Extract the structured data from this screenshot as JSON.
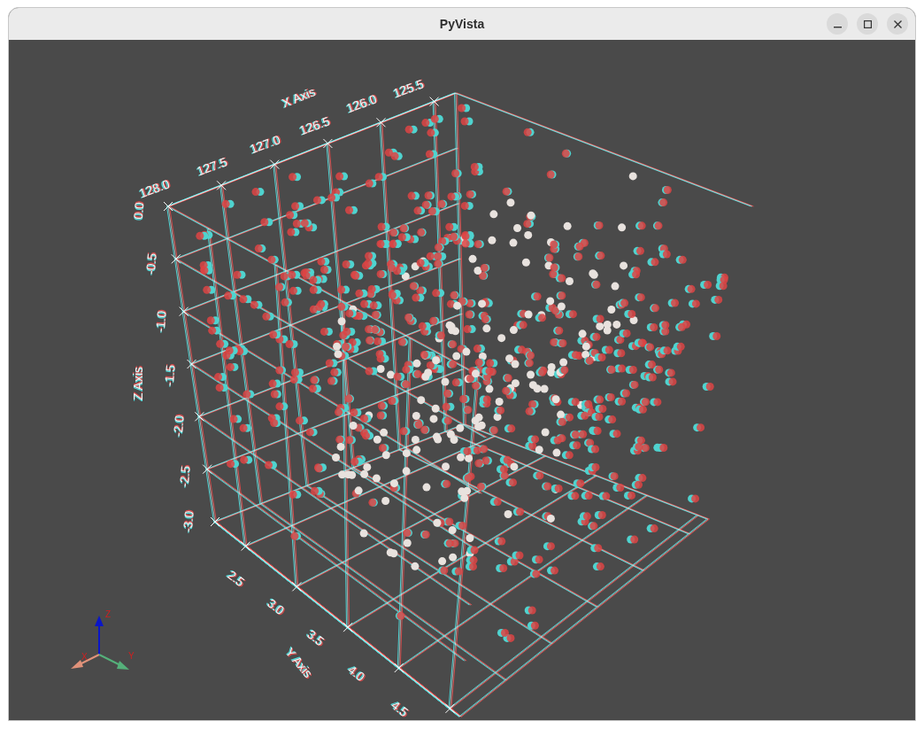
{
  "window": {
    "title": "PyVista"
  },
  "plot": {
    "x_axis": {
      "title": "X Axis",
      "ticks": [
        "128.0",
        "127.5",
        "127.0",
        "126.5",
        "126.0",
        "125.5"
      ]
    },
    "y_axis": {
      "title": "Y Axis",
      "ticks": [
        "2.5",
        "3.0",
        "3.5",
        "4.0",
        "4.5"
      ]
    },
    "z_axis": {
      "title": "Z Axis",
      "ticks": [
        "0.0",
        "-0.5",
        "-1.0",
        "-1.5",
        "-2.0",
        "-2.5",
        "-3.0"
      ]
    },
    "orientation_widget": {
      "labels": [
        "Z",
        "X",
        "Y"
      ]
    }
  }
}
